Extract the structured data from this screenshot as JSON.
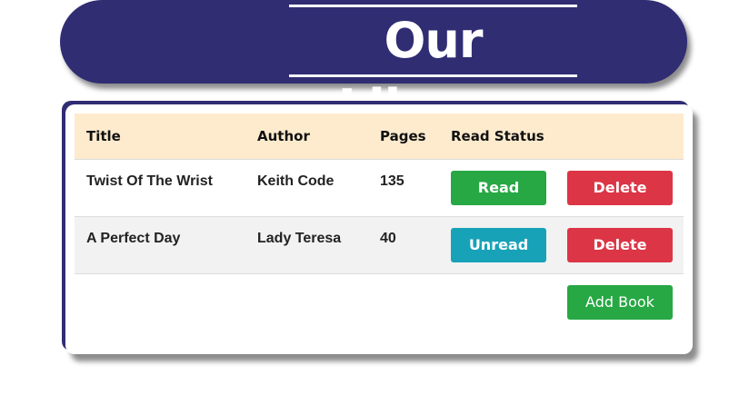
{
  "header": {
    "title": "Our Library"
  },
  "table": {
    "columns": [
      "Title",
      "Author",
      "Pages",
      "Read Status",
      ""
    ],
    "rows": [
      {
        "title": "Twist Of The Wrist",
        "author": "Keith Code",
        "pages": "135",
        "status_label": "Read",
        "delete_label": "Delete"
      },
      {
        "title": "A Perfect Day",
        "author": "Lady Teresa",
        "pages": "40",
        "status_label": "Unread",
        "delete_label": "Delete"
      }
    ]
  },
  "actions": {
    "add_book_label": "Add Book"
  },
  "colors": {
    "header_bg": "#302d73",
    "table_head_bg": "#feebcd",
    "read_green": "#27a844",
    "unread_teal": "#18a2b8",
    "delete_red": "#dc3546"
  }
}
